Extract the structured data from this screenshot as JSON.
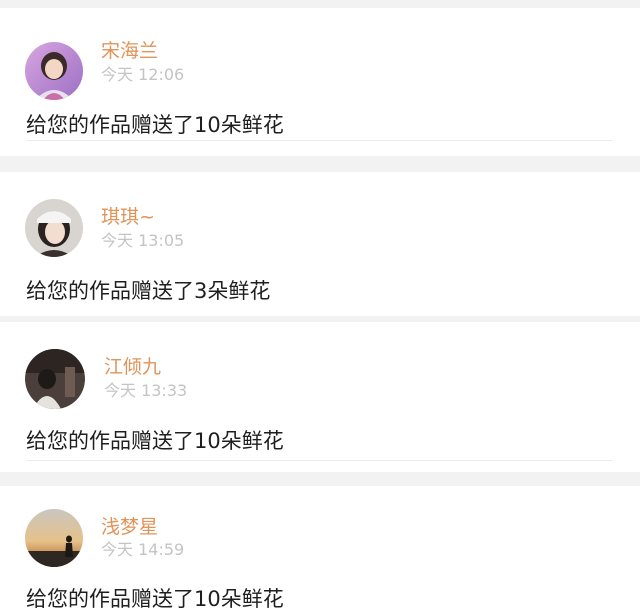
{
  "notifications": [
    {
      "name": "宋海兰",
      "time": "今天 12:06",
      "message": "给您的作品赠送了10朵鲜花",
      "avatar_icon": "avatar-girl-purple-icon"
    },
    {
      "name": "琪琪~",
      "time": "今天 13:05",
      "message": "给您的作品赠送了3朵鲜花",
      "avatar_icon": "avatar-girl-cap-icon"
    },
    {
      "name": "江倾九",
      "time": "今天 13:33",
      "message": "给您的作品赠送了10朵鲜花",
      "avatar_icon": "avatar-dark-scene-icon"
    },
    {
      "name": "浅梦星",
      "time": "今天 14:59",
      "message": "给您的作品赠送了10朵鲜花",
      "avatar_icon": "avatar-sunset-silhouette-icon"
    }
  ],
  "colors": {
    "name": "#e0945a",
    "time": "#c4c4c4",
    "message": "#1f1f1f",
    "card": "#ffffff",
    "background": "#f2f2f2"
  }
}
